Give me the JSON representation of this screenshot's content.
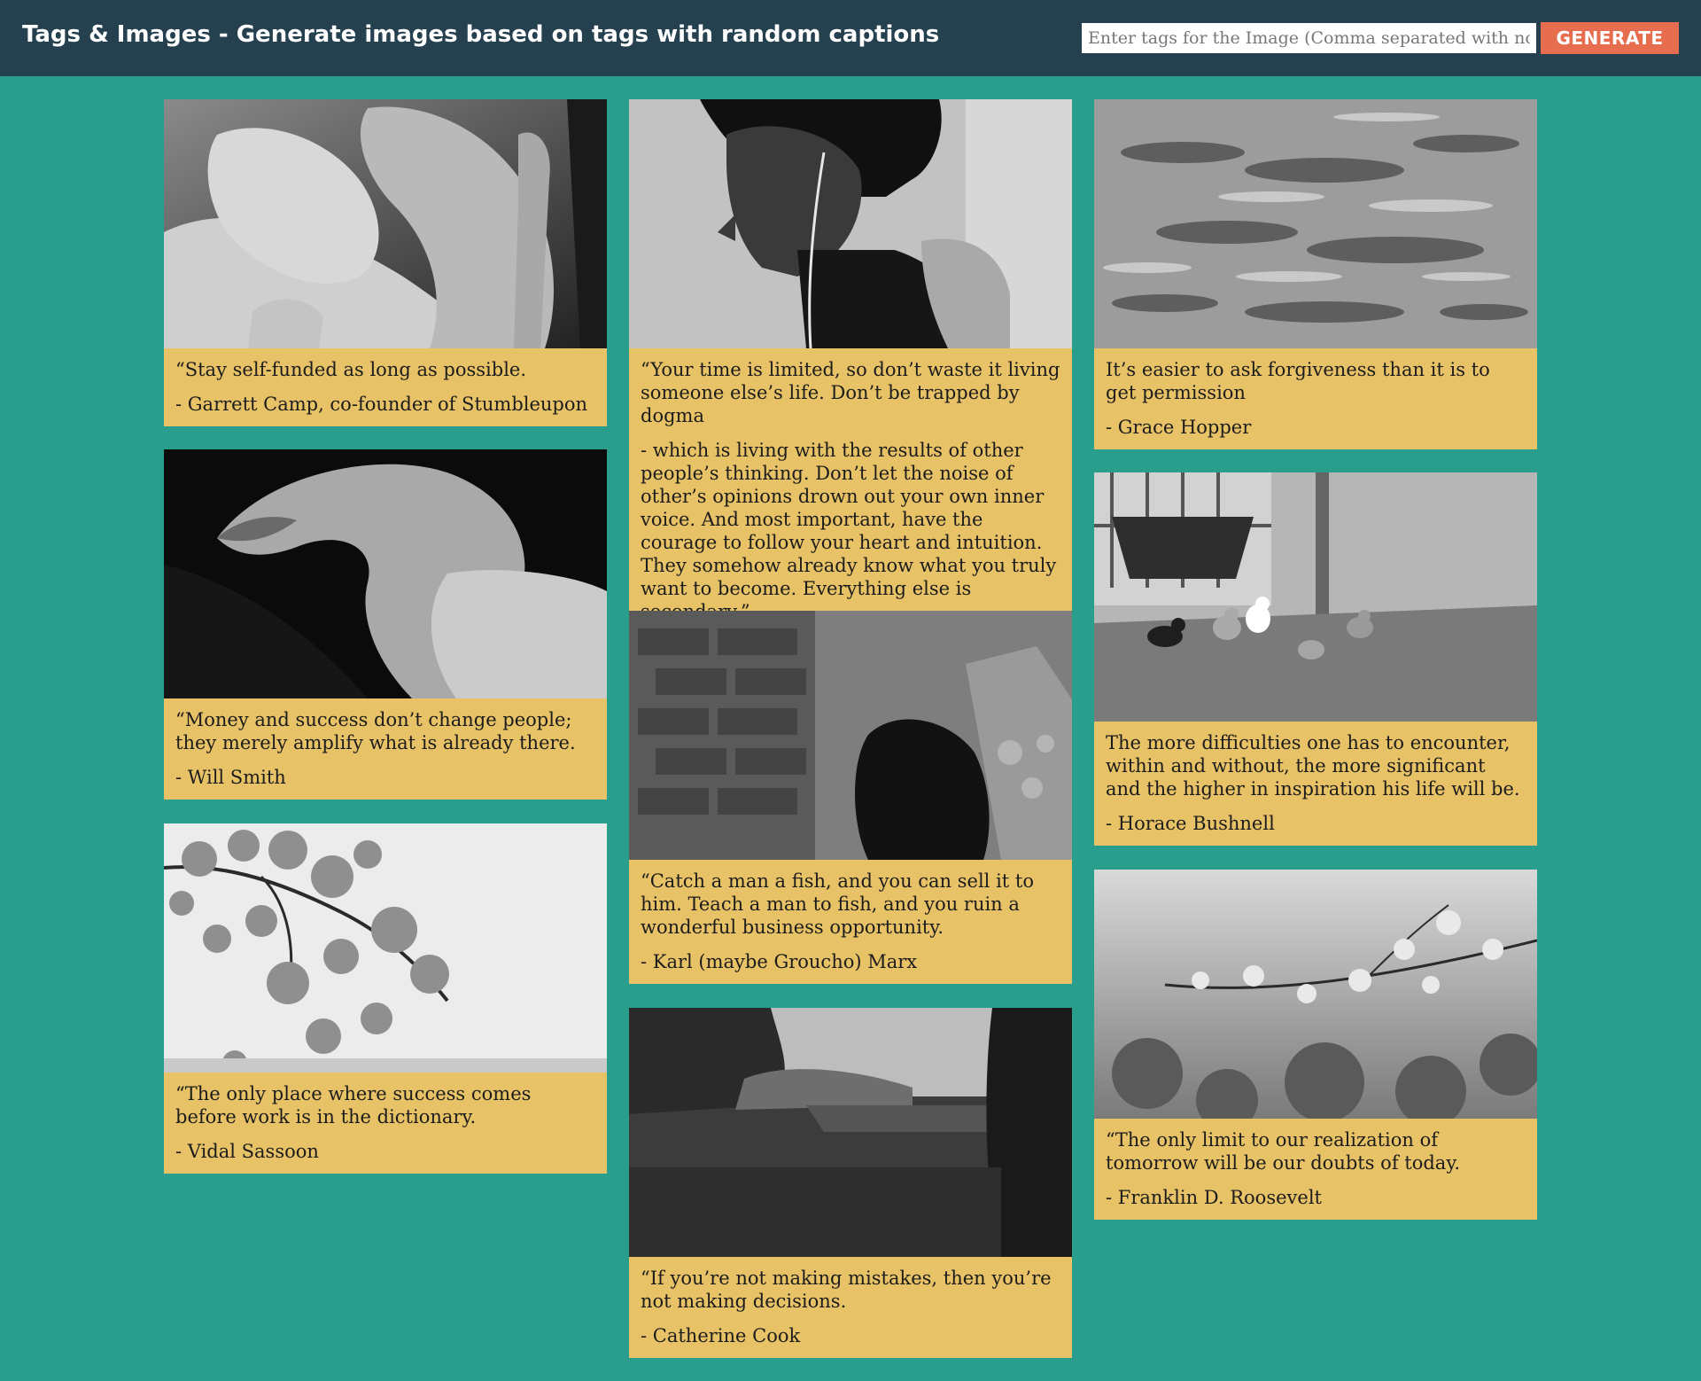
{
  "header": {
    "title": "Tags & Images - Generate images based on tags with random captions",
    "input_placeholder": "Enter tags for the Image (Comma separated with no spaces)",
    "generate_label": "GENERATE"
  },
  "cards": [
    {
      "quote": "“Stay self-funded as long as possible.",
      "author": "- Garrett Camp, co-founder of Stumbleupon"
    },
    {
      "quote": "“Money and success don’t change people; they merely amplify what is already there.",
      "author": "- Will Smith"
    },
    {
      "quote": "“The only place where success comes before work is in the dictionary.",
      "author": "- Vidal Sassoon"
    },
    {
      "quote": "“Your time is limited, so don’t waste it living someone else’s life. Don’t be trapped by dogma",
      "author": "- which is living with the results of other people’s thinking. Don’t let the noise of other’s opinions drown out your own inner voice. And most important, have the courage to follow your heart and intuition. They somehow already know what you truly want to become. Everything else is secondary.”"
    },
    {
      "quote": "“Catch a man a fish, and you can sell it to him. Teach a man to fish, and you ruin a wonderful business opportunity.",
      "author": "- Karl (maybe Groucho) Marx"
    },
    {
      "quote": "“If you’re not making mistakes, then you’re not making decisions.",
      "author": "- Catherine Cook"
    },
    {
      "quote": "It’s easier to ask forgiveness than it is to get permission",
      "author": "- Grace Hopper"
    },
    {
      "quote": "The more difficulties one has to encounter, within and without, the more significant and the higher in inspiration his life will be.",
      "author": "- Horace Bushnell"
    },
    {
      "quote": "“The only limit to our realization of tomorrow will be our doubts of today.",
      "author": "- Franklin D. Roosevelt"
    }
  ]
}
